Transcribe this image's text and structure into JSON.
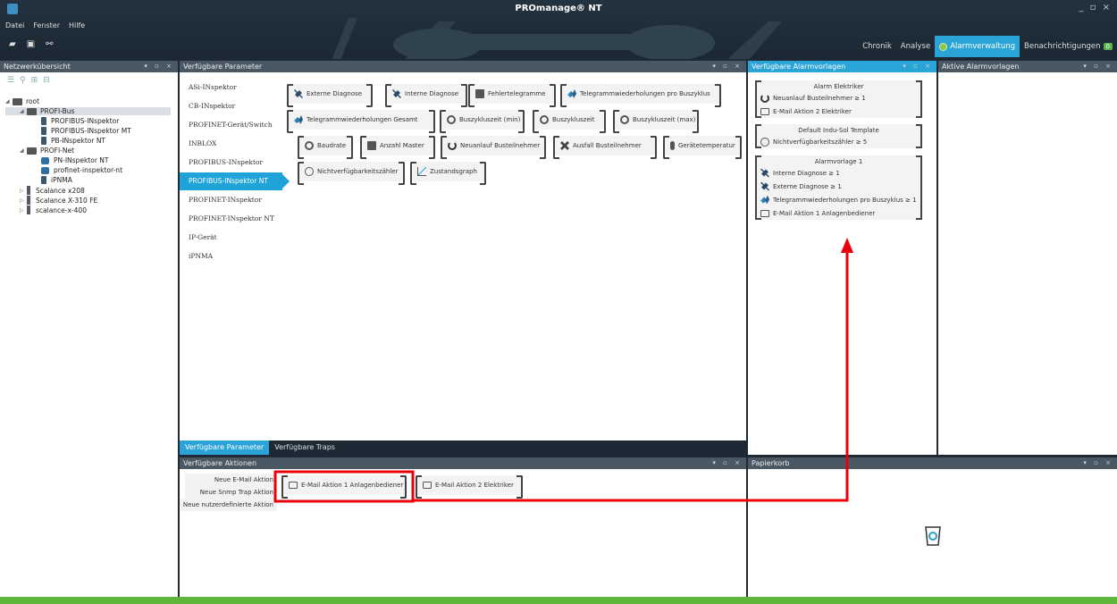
{
  "window": {
    "title": "PROmanage® NT",
    "controls": "_ ▫ ×"
  },
  "menu": [
    "Datei",
    "Fenster",
    "Hilfe"
  ],
  "top_tabs": [
    {
      "label": "Chronik"
    },
    {
      "label": "Analyse"
    },
    {
      "label": "Alarmverwaltung",
      "active": true
    },
    {
      "label": "Benachrichtigungen",
      "badge": "0"
    }
  ],
  "panels": {
    "network": "Netzwerkübersicht",
    "params": "Verfügbare Parameter",
    "templates": "Verfügbare Alarmvorlagen",
    "active_templates": "Aktive Alarmvorlagen",
    "actions": "Verfügbare Aktionen",
    "trash": "Papierkorb",
    "panel_controls": "▾ ▫ ×"
  },
  "tree": [
    {
      "label": "root",
      "level": 0,
      "type": "folder",
      "exp": "◢"
    },
    {
      "label": "PROFI-Bus",
      "level": 1,
      "type": "folder",
      "exp": "◢",
      "sel": true
    },
    {
      "label": "PROFIBUS-INspektor",
      "level": 2,
      "type": "dev"
    },
    {
      "label": "PROFIBUS-INspektor MT",
      "level": 2,
      "type": "dev"
    },
    {
      "label": "PB-INspektor NT",
      "level": 2,
      "type": "dev"
    },
    {
      "label": "PROFI-Net",
      "level": 1,
      "type": "folder",
      "exp": "◢"
    },
    {
      "label": "PN-INspektor NT",
      "level": 2,
      "type": "devb"
    },
    {
      "label": "profinet-inspektor-nt",
      "level": 2,
      "type": "devb"
    },
    {
      "label": "iPNMA",
      "level": 2,
      "type": "dev"
    },
    {
      "label": "Scalance x208",
      "level": 1,
      "type": "sw",
      "exp": "▷"
    },
    {
      "label": "Scalance X-310 FE",
      "level": 1,
      "type": "sw",
      "exp": "▷"
    },
    {
      "label": "scalance-x-400",
      "level": 1,
      "type": "sw",
      "exp": "▷"
    }
  ],
  "param_list": [
    {
      "label": "ASi-INspektor"
    },
    {
      "label": "CB-INspektor"
    },
    {
      "label": "PROFINET-Gerät/Switch"
    },
    {
      "label": "INBLOX"
    },
    {
      "label": "PROFIBUS-INspektor"
    },
    {
      "label": "PROFIBUS-INspektor NT",
      "active": true
    },
    {
      "label": "PROFINET-INspektor"
    },
    {
      "label": "PROFINET-INspektor NT"
    },
    {
      "label": "IP-Gerät"
    },
    {
      "label": "iPNMA"
    }
  ],
  "param_chips": [
    {
      "label": "Externe Diagnose",
      "icon": "wrench-icon"
    },
    {
      "label": "Interne Diagnose",
      "icon": "wrench-icon"
    },
    {
      "label": "Fehlertelegramme",
      "icon": "error-frame-icon"
    },
    {
      "label": "Telegrammwiederholungen pro Buszyklus",
      "icon": "repeat-arrow-icon"
    },
    {
      "label": "Telegrammwiederholungen Gesamt",
      "icon": "repeat-arrow-icon"
    },
    {
      "label": "Buszykluszeit (min)",
      "icon": "clock-icon"
    },
    {
      "label": "Buszykluszeit",
      "icon": "clock-icon"
    },
    {
      "label": "Buszykluszeit (max)",
      "icon": "clock-icon"
    },
    {
      "label": "Baudrate",
      "icon": "speed-icon"
    },
    {
      "label": "Anzahl Master",
      "icon": "master-icon"
    },
    {
      "label": "Neuanlauf Busteilnehmer",
      "icon": "power-icon"
    },
    {
      "label": "Ausfall Busteilnehmer",
      "icon": "x-icon"
    },
    {
      "label": "Gerätetemperatur",
      "icon": "thermometer-icon"
    },
    {
      "label": "Nichtverfügbarkeitszähler",
      "icon": "counter-icon"
    },
    {
      "label": "Zustandsgraph",
      "icon": "graph-icon"
    }
  ],
  "param_tabs": [
    {
      "label": "Verfügbare Parameter",
      "active": true
    },
    {
      "label": "Verfügbare Traps"
    }
  ],
  "templates": [
    {
      "title": "Alarm Elektriker",
      "rows": [
        {
          "label": "Neuanlauf Busteilnehmer  ≥  1",
          "icon": "power-icon"
        },
        {
          "label": "E-Mail Aktion 2 Elektriker",
          "icon": "mail-icon"
        }
      ]
    },
    {
      "title": "Default Indu-Sol Template",
      "rows": [
        {
          "label": "Nichtverfügbarkeitszähler  ≥  5",
          "icon": "counter-icon"
        }
      ]
    },
    {
      "title": "Alarmvorlage 1",
      "rows": [
        {
          "label": "Interne Diagnose  ≥  1",
          "icon": "wrench-icon"
        },
        {
          "label": "Externe Diagnose  ≥  1",
          "icon": "wrench-icon"
        },
        {
          "label": "Telegrammwiederholungen pro Buszyklus  ≥  1",
          "icon": "repeat-arrow-icon"
        },
        {
          "label": "E-Mail Aktion 1 Anlagenbediener",
          "icon": "mail-icon"
        }
      ]
    }
  ],
  "actions_list": [
    "Neue E-Mail Aktion",
    "Neue Snmp Trap Aktion",
    "Neue nutzerdefinierte Aktion"
  ],
  "action_chips": [
    {
      "label": "E-Mail Aktion 1 Anlagenbediener",
      "icon": "mail-icon"
    },
    {
      "label": "E-Mail Aktion 2 Elektriker",
      "icon": "mail-icon"
    }
  ],
  "colors": {
    "accent": "#2aa4d6",
    "dark": "#1d2a35",
    "annotation": "#e8000b",
    "status": "#5fb53b"
  }
}
